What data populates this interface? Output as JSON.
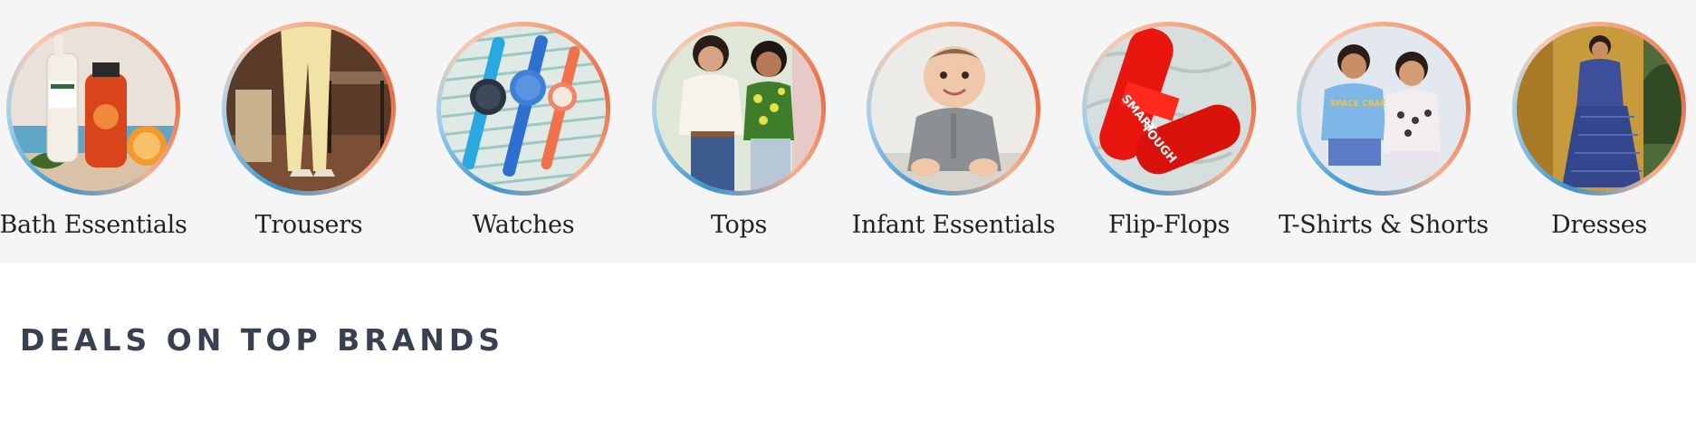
{
  "categories": [
    {
      "label": "Bath Essentials",
      "image": "bath-essentials-products-image"
    },
    {
      "label": "Trousers",
      "image": "trousers-model-image"
    },
    {
      "label": "Watches",
      "image": "watches-image"
    },
    {
      "label": "Tops",
      "image": "tops-models-image"
    },
    {
      "label": "Infant Essentials",
      "image": "infant-baby-image"
    },
    {
      "label": "Flip-Flops",
      "image": "flip-flops-image",
      "print_text": [
        "SMART",
        "TOUGH"
      ]
    },
    {
      "label": "T-Shirts & Shorts",
      "image": "kids-tshirts-image",
      "print_text": [
        "SPACE CRAFT"
      ]
    },
    {
      "label": "Dresses",
      "image": "dress-model-image"
    }
  ],
  "section": {
    "title": "DEALS ON TOP BRANDS"
  },
  "colors": {
    "strip_background": "#f5f5f5",
    "ring_blue": "#3c93cf",
    "ring_orange": "#e86c45",
    "heading": "#3b3f52"
  }
}
